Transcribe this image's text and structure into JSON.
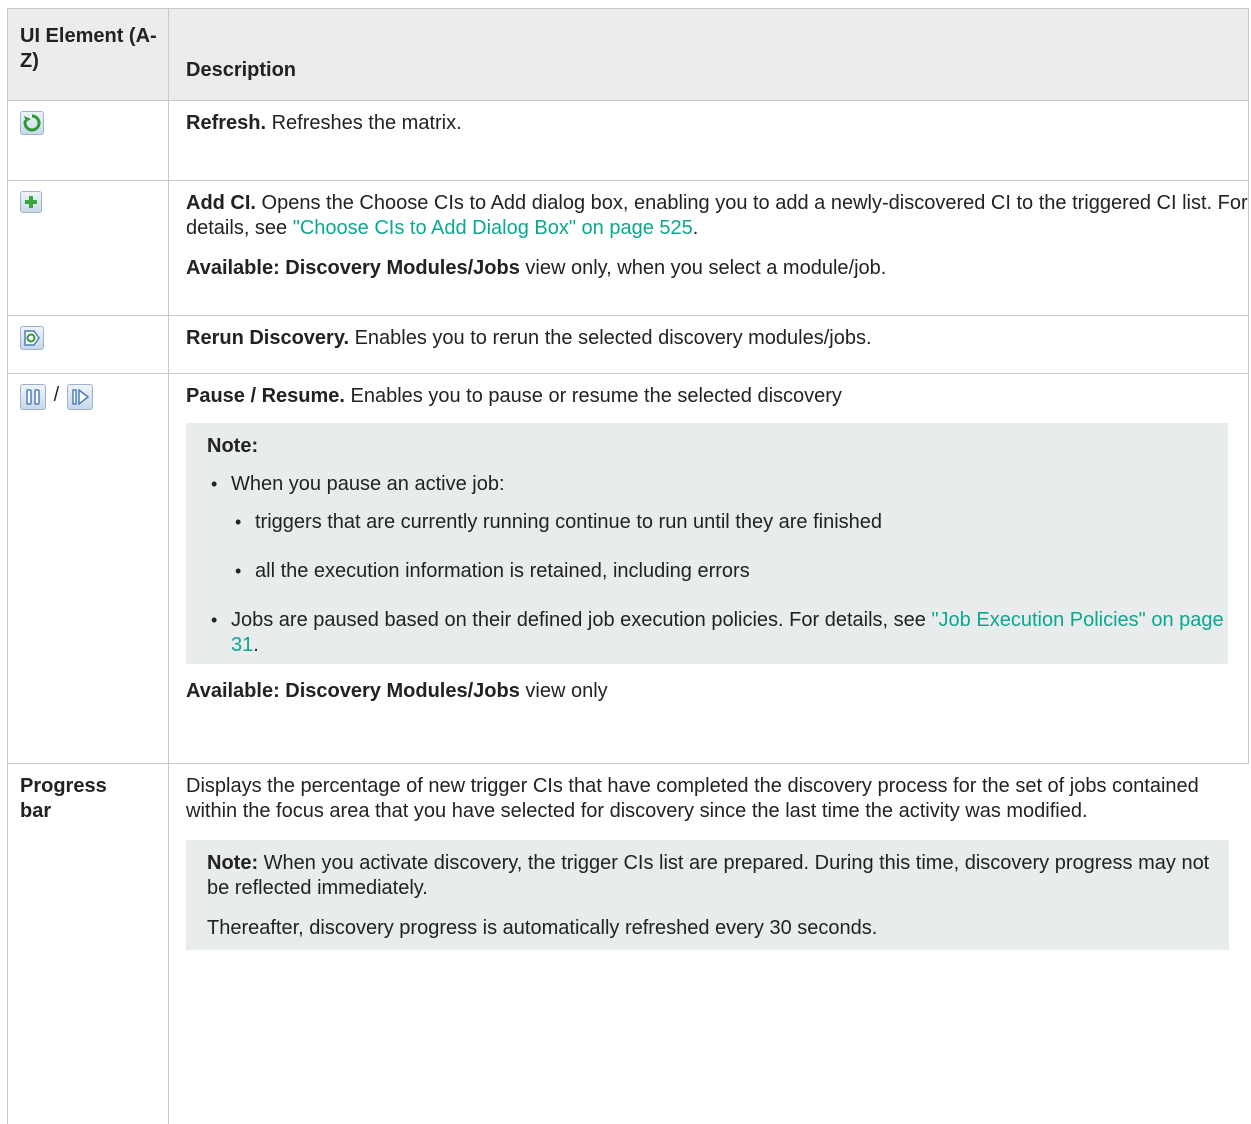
{
  "table": {
    "headers": {
      "element": "UI Element (A-Z)",
      "description": "Description"
    },
    "rows": [
      {
        "icon": "refresh-icon",
        "title": "Refresh.",
        "text": " Refreshes the matrix."
      },
      {
        "icon": "add-ci-icon",
        "title": "Add CI.",
        "text": " Opens the Choose CIs to Add dialog box, enabling you to add a newly-discovered CI to the triggered CI list. For details, see ",
        "link": "\"Choose CIs to Add Dialog Box\" on page 525",
        "text_after": ".",
        "avail_label": "Available: Discovery Modules/Jobs",
        "avail_text": " view only, when you select a module/job."
      },
      {
        "icon": "rerun-discovery-icon",
        "title": "Rerun Discovery.",
        "text": " Enables you to rerun the selected discovery modules/jobs."
      },
      {
        "icons": [
          "pause-icon",
          "resume-icon"
        ],
        "separator": "/",
        "title": "Pause / Resume.",
        "text": " Enables you to pause or resume the selected discovery",
        "note_label": "Note:",
        "bullet1": "When you pause an active job:",
        "sub1": "triggers that are currently running continue to run until they are finished",
        "sub2": "all the execution information is retained, including errors",
        "bullet2": "Jobs are paused based on their defined job execution policies. For details, see ",
        "bullet2_link": "\"Job Execution Policies\" on page 31",
        "bullet2_after": ".",
        "avail_label": "Available: Discovery Modules/Jobs",
        "avail_text": " view only"
      },
      {
        "element_label": "Progress bar",
        "text": "Displays the percentage of new trigger CIs that have completed the discovery process for the set of jobs contained within the focus area that you have selected for discovery since the last time the activity was modified.",
        "note_label": "Note:",
        "note_text": " When you activate discovery, the trigger CIs list are prepared. During this time, discovery progress may not be reflected immediately.",
        "note_text2": "Thereafter, discovery progress is automatically refreshed every 30 seconds."
      }
    ]
  }
}
